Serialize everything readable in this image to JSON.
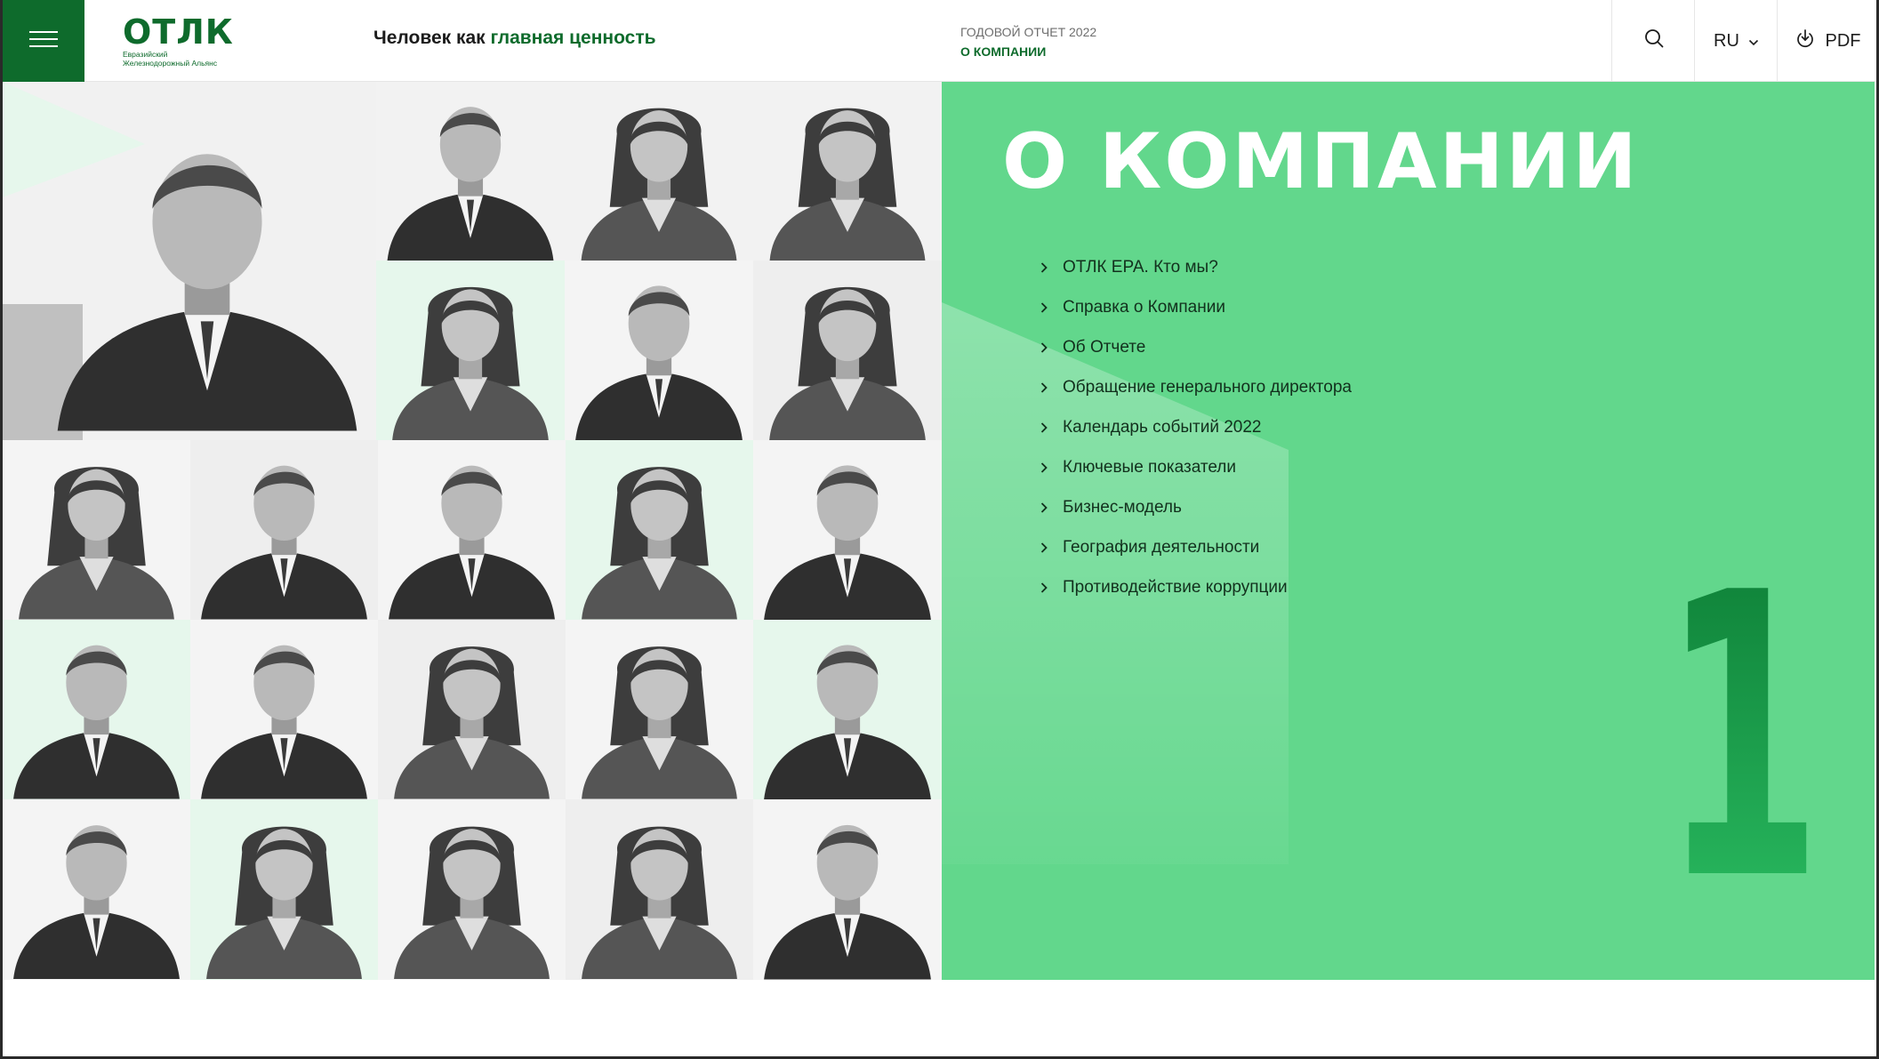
{
  "header": {
    "logo_word": "ОТЛК",
    "logo_subtitle_line1": "Евразийский",
    "logo_subtitle_line2": "Железнодорожный Альянс",
    "slogan_plain": "Человек как ",
    "slogan_accent": "главная ценность",
    "report_label": "ГОДОВОЙ ОТЧЕТ 2022",
    "breadcrumb_current": "О КОМПАНИИ",
    "language": "RU",
    "pdf_label": "PDF",
    "icons": [
      "menu-icon",
      "search-icon",
      "chevron-down-icon",
      "download-icon"
    ]
  },
  "panel": {
    "title": "О КОМПАНИИ",
    "chapter_number": "1",
    "menu": [
      "ОТЛК ЕРА. Кто мы?",
      "Справка о Компании",
      "Об Отчете",
      "Обращение генерального директора",
      "Календарь событий 2022",
      "Ключевые показатели",
      "Бизнес-модель",
      "География деятельности",
      "Противодействие коррупции"
    ]
  },
  "colors": {
    "brand_green": "#0e6b2c",
    "panel_green": "#62d78c",
    "light_mint": "#e6f7ec",
    "photo_gray": "#f0f0f0"
  }
}
